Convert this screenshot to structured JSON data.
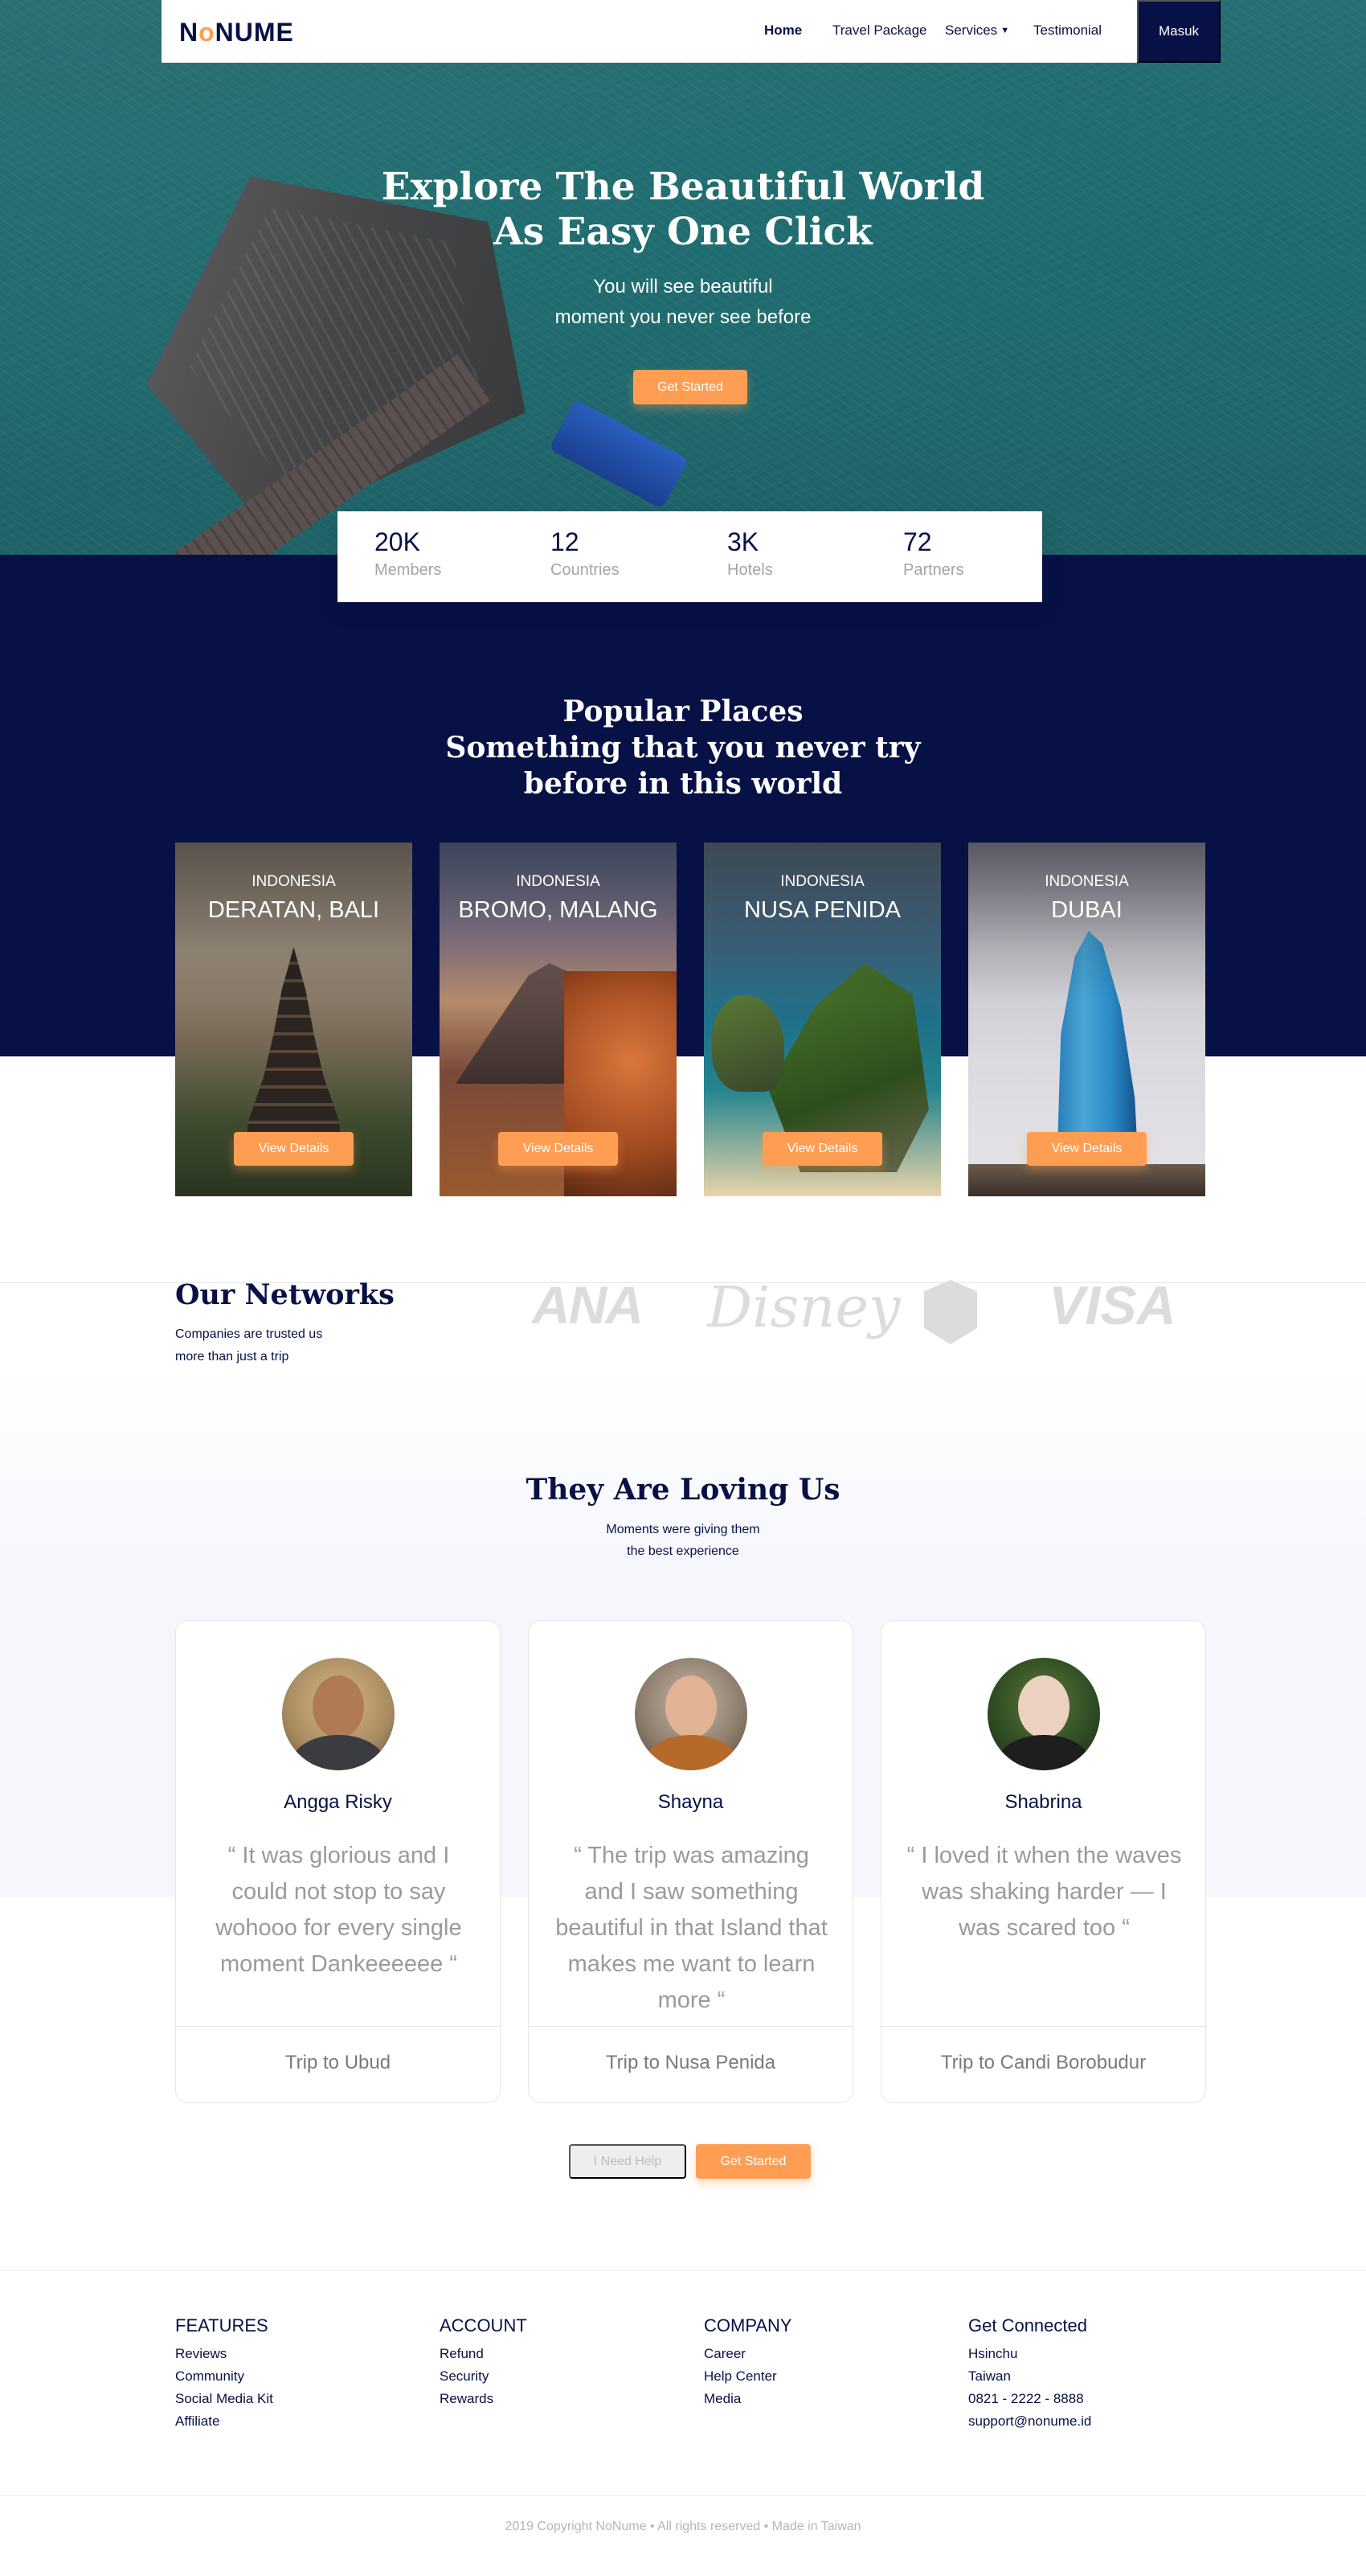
{
  "nav": {
    "logo_a": "N",
    "logo_b": "NUME",
    "items": [
      "Home",
      "Travel Package",
      "Services",
      "Testimonial"
    ],
    "login": "Masuk"
  },
  "hero": {
    "title_1": "Explore The Beautiful World",
    "title_2": "As Easy One Click",
    "subtitle_1": "You will see beautiful",
    "subtitle_2": "moment you never see before",
    "cta": "Get Started"
  },
  "stats": [
    {
      "value": "20K",
      "label": "Members"
    },
    {
      "value": "12",
      "label": "Countries"
    },
    {
      "value": "3K",
      "label": "Hotels"
    },
    {
      "value": "72",
      "label": "Partners"
    }
  ],
  "popular": {
    "title_1": "Popular Places",
    "title_2": "Something that you never try",
    "title_3": "before in this world",
    "places": [
      {
        "country": "INDONESIA",
        "city": "DERATAN, BALI",
        "button": "View Details"
      },
      {
        "country": "INDONESIA",
        "city": "BROMO, MALANG",
        "button": "View Details"
      },
      {
        "country": "INDONESIA",
        "city": "NUSA PENIDA",
        "button": "View Details"
      },
      {
        "country": "INDONESIA",
        "city": "DUBAI",
        "button": "View Details"
      }
    ]
  },
  "networks": {
    "title": "Our Networks",
    "desc_1": "Companies are trusted us",
    "desc_2": "more than just a trip",
    "partners": [
      "ANA",
      "Disney",
      "shield",
      "VISA"
    ]
  },
  "testimonials": {
    "title": "They Are Loving Us",
    "sub_1": "Moments were giving them",
    "sub_2": "the best experience",
    "items": [
      {
        "name": "Angga Risky",
        "quote": "“ It was glorious and I could not stop to say wohooo for every single moment Dankeeeeee “",
        "trip": "Trip to Ubud"
      },
      {
        "name": "Shayna",
        "quote": "“ The trip was amazing and I saw something beautiful in that Island that makes me want to learn more “",
        "trip": "Trip to Nusa Penida"
      },
      {
        "name": "Shabrina",
        "quote": "“ I loved it when the waves was shaking harder — I was scared too “",
        "trip": "Trip to Candi Borobudur"
      }
    ],
    "help": "I Need Help",
    "cta": "Get Started"
  },
  "footer": {
    "cols": [
      {
        "head": "FEATURES",
        "links": [
          "Reviews",
          "Community",
          "Social Media Kit",
          "Affiliate"
        ]
      },
      {
        "head": "ACCOUNT",
        "links": [
          "Refund",
          "Security",
          "Rewards"
        ]
      },
      {
        "head": "COMPANY",
        "links": [
          "Career",
          "Help Center",
          "Media"
        ]
      },
      {
        "head": "Get Connected",
        "links": [
          "Hsinchu",
          "Taiwan",
          "0821 - 2222 - 8888",
          "support@nonume.id"
        ]
      }
    ],
    "copyright": "2019 Copyright NoNume • All rights reserved • Made in Taiwan"
  },
  "colors": {
    "navy": "#071146",
    "orange": "#ff9e53"
  }
}
